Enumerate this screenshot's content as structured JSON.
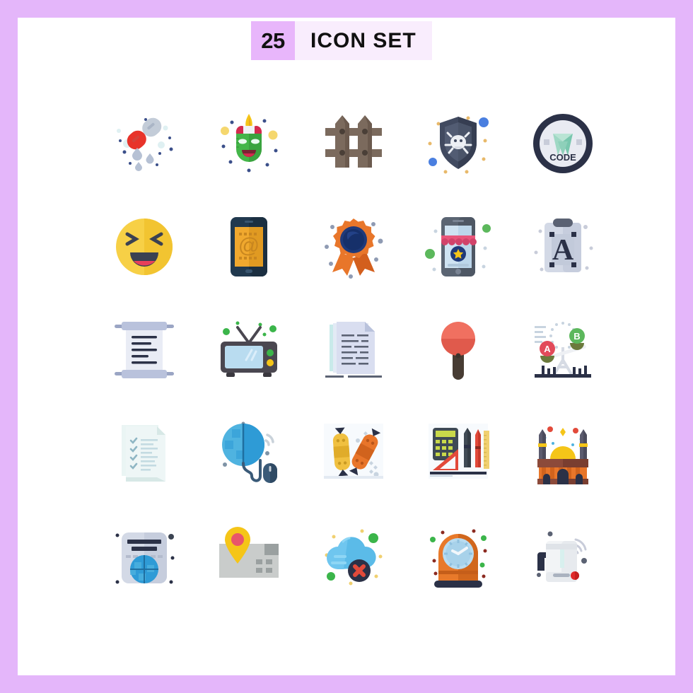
{
  "frame": {
    "border_color": "#e4b6fa",
    "canvas_color": "#ffffff"
  },
  "header": {
    "count": "25",
    "count_bg": "#e8b6fb",
    "title": "ICON SET",
    "title_bg": "#f9edfd"
  },
  "grid": {
    "columns": 5,
    "rows": 5,
    "total": 25
  },
  "icons": [
    {
      "name": "pills-drops-icon",
      "label": "Capsule pills with water drops",
      "row": 1,
      "col": 1,
      "colors": [
        "#e8332a",
        "#c3ccd8",
        "#b6c1d4",
        "#dceff0"
      ]
    },
    {
      "name": "carnival-mask-icon",
      "label": "Carnival jester mask",
      "row": 1,
      "col": 2,
      "colors": [
        "#44b649",
        "#d32a4e",
        "#f5c518",
        "#f5d76e"
      ]
    },
    {
      "name": "fence-icon",
      "label": "Wooden garden fence",
      "row": 1,
      "col": 3,
      "colors": [
        "#7b6a5d",
        "#6b5a4e",
        "#4a3f37"
      ]
    },
    {
      "name": "antivirus-shield-icon",
      "label": "Shield with virus skull",
      "row": 1,
      "col": 4,
      "colors": [
        "#414a60",
        "#525c73",
        "#eceff4",
        "#4a7fe0",
        "#e8b96a"
      ]
    },
    {
      "name": "code-badge-icon",
      "label": "Code badge with diamond",
      "row": 1,
      "col": 5,
      "colors": [
        "#2b3147",
        "#e9ebf2",
        "#9fd8c4",
        "#79c7ae"
      ],
      "text": "CODE"
    },
    {
      "name": "laughing-emoji-icon",
      "label": "Laughing face emoji",
      "row": 2,
      "col": 1,
      "colors": [
        "#f7d046",
        "#3b4152",
        "#e8405a"
      ]
    },
    {
      "name": "mobile-email-icon",
      "label": "Smartphone with email at symbol",
      "row": 2,
      "col": 2,
      "colors": [
        "#21394f",
        "#f0a82e",
        "#c8861f"
      ],
      "text": "@"
    },
    {
      "name": "award-badge-icon",
      "label": "Award rosette with ribbon",
      "row": 2,
      "col": 3,
      "colors": [
        "#e8762a",
        "#d35f1d",
        "#1f3a7a",
        "#16306a"
      ]
    },
    {
      "name": "mobile-shop-icon",
      "label": "Mobile shop with awning and star",
      "row": 2,
      "col": 4,
      "colors": [
        "#5b6573",
        "#cfe3f2",
        "#e8557a",
        "#1f3a7a",
        "#f5c518",
        "#5cb85c"
      ]
    },
    {
      "name": "typography-clipboard-icon",
      "label": "Clipboard with letter A",
      "row": 2,
      "col": 5,
      "colors": [
        "#d3d9e6",
        "#5b6273",
        "#2b3147"
      ],
      "text": "A"
    },
    {
      "name": "scroll-document-icon",
      "label": "Paper scroll with text",
      "row": 3,
      "col": 1,
      "colors": [
        "#b9c2dc",
        "#e9ecf5",
        "#2b3147"
      ]
    },
    {
      "name": "television-icon",
      "label": "Retro television set",
      "row": 3,
      "col": 2,
      "colors": [
        "#4a4750",
        "#b9dcf0",
        "#5cb85c",
        "#f5c518"
      ]
    },
    {
      "name": "documents-icon",
      "label": "Stacked paper documents",
      "row": 3,
      "col": 3,
      "colors": [
        "#d9def0",
        "#c9eaea",
        "#5b6273"
      ]
    },
    {
      "name": "baby-rattle-icon",
      "label": "Red lollipop rattle",
      "row": 3,
      "col": 4,
      "colors": [
        "#f07060",
        "#d85a4c",
        "#473c33"
      ]
    },
    {
      "name": "ab-testing-scale-icon",
      "label": "Balance scale A B testing",
      "row": 3,
      "col": 5,
      "colors": [
        "#e24a5a",
        "#5cb85c",
        "#2b3147",
        "#6b7a3c"
      ],
      "text": "A B"
    },
    {
      "name": "checklist-document-icon",
      "label": "Checklist on paper",
      "row": 4,
      "col": 1,
      "colors": [
        "#eaf5f4",
        "#d7e8e6",
        "#8fb6c4"
      ]
    },
    {
      "name": "internet-globe-mouse-icon",
      "label": "Globe with computer mouse wifi",
      "row": 4,
      "col": 2,
      "colors": [
        "#2e9bd6",
        "#4fb3e0",
        "#3a5a78",
        "#c9d2da"
      ]
    },
    {
      "name": "skateboards-icon",
      "label": "Two skateboards",
      "row": 4,
      "col": 3,
      "colors": [
        "#f0c040",
        "#e8752a",
        "#2b3147",
        "#f5f8fb"
      ]
    },
    {
      "name": "stationery-icon",
      "label": "Calculator pen pencil ruler set",
      "row": 4,
      "col": 4,
      "colors": [
        "#3f4a55",
        "#c9d94a",
        "#e24a3a",
        "#f0d070",
        "#2b3147"
      ]
    },
    {
      "name": "mosque-icon",
      "label": "Mosque with golden dome",
      "row": 4,
      "col": 5,
      "colors": [
        "#8c4a3a",
        "#e8762a",
        "#f5c518",
        "#5b5b6e",
        "#2b3147"
      ]
    },
    {
      "name": "webpage-globe-icon",
      "label": "Document with globe web page",
      "row": 5,
      "col": 1,
      "colors": [
        "#d3d9e6",
        "#2e9bd6",
        "#2b3147"
      ]
    },
    {
      "name": "map-location-icon",
      "label": "Map with location pin",
      "row": 5,
      "col": 2,
      "colors": [
        "#c9cccb",
        "#f5c518",
        "#e8556a",
        "#9aa0a0"
      ]
    },
    {
      "name": "cloud-error-icon",
      "label": "Cloud with error cross",
      "row": 5,
      "col": 3,
      "colors": [
        "#5bbbe8",
        "#2b3147",
        "#e24a3a",
        "#5cb85c"
      ]
    },
    {
      "name": "table-clock-icon",
      "label": "Orange table clock",
      "row": 5,
      "col": 4,
      "colors": [
        "#e8792a",
        "#d1671d",
        "#b9dcf0",
        "#2b3147"
      ]
    },
    {
      "name": "smart-kettle-icon",
      "label": "Smart kettle with wifi",
      "row": 5,
      "col": 5,
      "colors": [
        "#f2f4f6",
        "#dfe3e8",
        "#2b3147",
        "#e02a2a"
      ]
    }
  ]
}
